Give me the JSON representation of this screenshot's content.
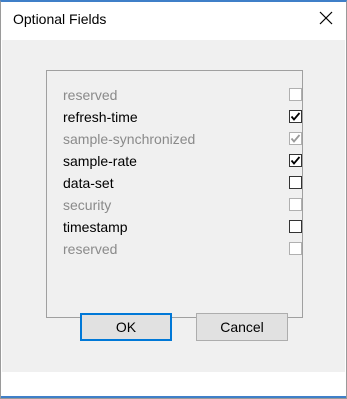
{
  "window": {
    "title": "Optional Fields",
    "close_icon": "close-icon"
  },
  "fields": [
    {
      "label": "reserved",
      "checked": false,
      "enabled": false
    },
    {
      "label": "refresh-time",
      "checked": true,
      "enabled": true
    },
    {
      "label": "sample-synchronized",
      "checked": true,
      "enabled": false
    },
    {
      "label": "sample-rate",
      "checked": true,
      "enabled": true
    },
    {
      "label": "data-set",
      "checked": false,
      "enabled": true
    },
    {
      "label": "security",
      "checked": false,
      "enabled": false
    },
    {
      "label": "timestamp",
      "checked": false,
      "enabled": true
    },
    {
      "label": "reserved",
      "checked": false,
      "enabled": false
    }
  ],
  "buttons": {
    "ok_label": "OK",
    "cancel_label": "Cancel"
  },
  "colors": {
    "accent": "#3f7fc8",
    "dialog_bg": "#f0f0f0",
    "disabled_text": "#8a8a8a"
  }
}
